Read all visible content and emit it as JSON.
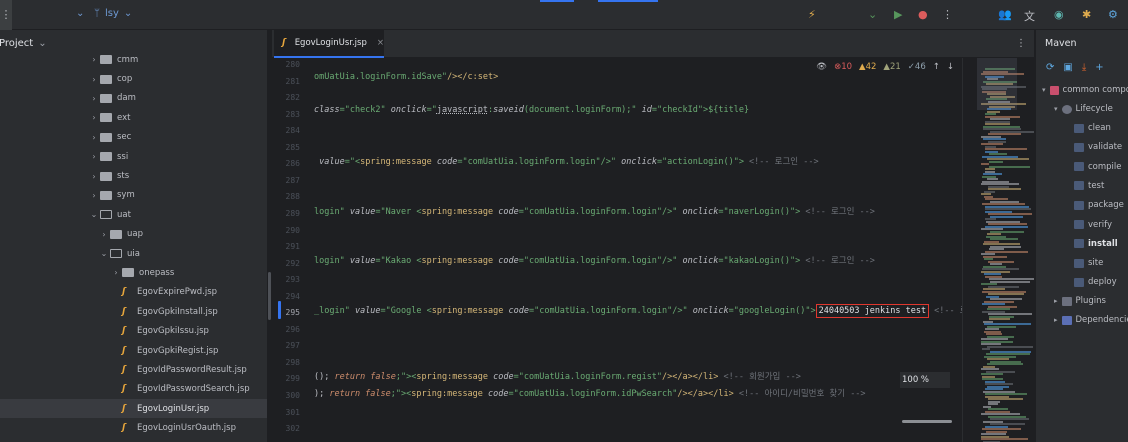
{
  "toolbar": {
    "menu_icon": "⋮",
    "vcs_chevron": "⌄",
    "branch_label": "lsy",
    "branch_chevron": "⌄",
    "right_icons": [
      {
        "name": "run-config-icon",
        "glyph": "⚡",
        "color": "#e0ac4e"
      },
      {
        "name": "run-config-chevron-icon",
        "glyph": "⌄",
        "color": "#57965c"
      },
      {
        "name": "run-icon",
        "glyph": "▶",
        "color": "#57965c"
      },
      {
        "name": "debug-icon",
        "glyph": "●",
        "color": "#db5c5c"
      },
      {
        "name": "more-actions-icon",
        "glyph": "⋮",
        "color": "#bcbec4"
      },
      {
        "name": "collab-icon",
        "glyph": "👥",
        "color": "#e0ac4e"
      },
      {
        "name": "translate-icon",
        "glyph": "文",
        "color": "#bcbec4"
      },
      {
        "name": "copilot-icon",
        "glyph": "◉",
        "color": "#5fb8b1"
      },
      {
        "name": "tools-icon",
        "glyph": "✱",
        "color": "#e0ac4e"
      },
      {
        "name": "settings-icon",
        "glyph": "⚙",
        "color": "#5fa8e0"
      }
    ]
  },
  "project": {
    "title": "Project",
    "title_chevron": "⌄",
    "tree": [
      {
        "label": "cmm",
        "type": "folder",
        "state": "closed",
        "indent": 88
      },
      {
        "label": "cop",
        "type": "folder",
        "state": "closed",
        "indent": 88
      },
      {
        "label": "dam",
        "type": "folder",
        "state": "closed",
        "indent": 88
      },
      {
        "label": "ext",
        "type": "folder",
        "state": "closed",
        "indent": 88
      },
      {
        "label": "sec",
        "type": "folder",
        "state": "closed",
        "indent": 88
      },
      {
        "label": "ssi",
        "type": "folder",
        "state": "closed",
        "indent": 88
      },
      {
        "label": "sts",
        "type": "folder",
        "state": "closed",
        "indent": 88
      },
      {
        "label": "sym",
        "type": "folder",
        "state": "closed",
        "indent": 88
      },
      {
        "label": "uat",
        "type": "folder",
        "state": "open",
        "indent": 88
      },
      {
        "label": "uap",
        "type": "folder",
        "state": "closed",
        "indent": 98
      },
      {
        "label": "uia",
        "type": "folder",
        "state": "open",
        "indent": 98
      },
      {
        "label": "onepass",
        "type": "folder",
        "state": "closed",
        "indent": 110
      },
      {
        "label": "EgovExpirePwd.jsp",
        "type": "jsp",
        "indent": 122
      },
      {
        "label": "EgovGpkiInstall.jsp",
        "type": "jsp",
        "indent": 122
      },
      {
        "label": "EgovGpkiIssu.jsp",
        "type": "jsp",
        "indent": 122
      },
      {
        "label": "EgovGpkiRegist.jsp",
        "type": "jsp",
        "indent": 122
      },
      {
        "label": "EgovIdPasswordResult.jsp",
        "type": "jsp",
        "indent": 122
      },
      {
        "label": "EgovIdPasswordSearch.jsp",
        "type": "jsp",
        "indent": 122
      },
      {
        "label": "EgovLoginUsr.jsp",
        "type": "jsp",
        "indent": 122,
        "selected": true
      },
      {
        "label": "EgovLoginUsrOauth.jsp",
        "type": "jsp",
        "indent": 122
      }
    ]
  },
  "editor": {
    "tab_label": "EgovLoginUsr.jsp",
    "tab_close": "×",
    "tabs_more": "⋮",
    "inspection": {
      "eye": "👁",
      "errors": "10",
      "warnings": "42",
      "weak_warnings": "21",
      "typos": "46",
      "up": "↑",
      "down": "↓"
    },
    "line_numbers": [
      "280",
      "281",
      "282",
      "283",
      "284",
      "285",
      "286",
      "287",
      "288",
      "289",
      "290",
      "291",
      "292",
      "293",
      "294",
      "295",
      "296",
      "297",
      "298",
      "299",
      "300",
      "301",
      "302"
    ],
    "current_line": "295",
    "zoom": "100 %",
    "lines": {
      "l281": {
        "a": "omUatUia.loginForm.idSave\"",
        "b": "/></",
        "c": "c:set",
        "d": ">"
      },
      "l283": {
        "a": "class",
        "b": "=\"check2\" ",
        "c": "onclick",
        "d": "=\"",
        "e": "javascript",
        "f": ":",
        "g": "saveid",
        "h": "(document.loginForm);\" ",
        "i": "id",
        "j": "=\"checkId\">${title}"
      },
      "l286": {
        "a": " value",
        "b": "=\"<",
        "c": "spring:message ",
        "d": "code",
        "e": "=\"comUatUia.loginForm.login\"",
        "f": "/>\" ",
        "g": "onclick",
        "h": "=\"actionLogin()\">",
        "i": " <!-- 로그인 -->"
      },
      "l289": {
        "a": "login\" ",
        "b": "value",
        "c": "=\"Naver <",
        "d": "spring:message ",
        "e": "code",
        "f": "=\"comUatUia.loginForm.login\"",
        "g": "/>\" ",
        "h": "onclick",
        "i": "=\"naverLogin()\">",
        "j": " <!-- 로그인 -->"
      },
      "l292": {
        "a": "login\" ",
        "b": "value",
        "c": "=\"Kakao <",
        "d": "spring:message ",
        "e": "code",
        "f": "=\"comUatUia.loginForm.login\"",
        "g": "/>\" ",
        "h": "onclick",
        "i": "=\"kakaoLogin()\">",
        "j": " <!-- 로그인 -->"
      },
      "l295": {
        "a": "_login\" ",
        "b": "value",
        "c": "=\"Google <",
        "d": "spring:message ",
        "e": "code",
        "f": "=\"comUatUia.loginForm.login\"",
        "g": "/>\" ",
        "h": "onclick",
        "i": "=\"googleLogin()\">",
        "boxed": "24040503 jenkins test",
        "j": " <!-- 로그인 -->"
      },
      "l299": {
        "a": "(); ",
        "b": "return false",
        "c": ";\"><",
        "d": "spring:message ",
        "e": "code",
        "f": "=\"comUatUia.loginForm.regist\"",
        "g": "/></",
        "h": "a",
        "i": "></",
        "j": "li",
        "k": ">",
        "l": " <!-- 회원가입 -->"
      },
      "l300": {
        "a": "); ",
        "b": "return false",
        "c": ";\"><",
        "d": "spring:message ",
        "e": "code",
        "f": "=\"comUatUia.loginForm.idPwSearch\"",
        "g": "/></",
        "h": "a",
        "i": "></",
        "j": "li",
        "k": ">",
        "l": " <!-- 아이디/비밀번호 찾기 -->"
      }
    }
  },
  "maven": {
    "title": "Maven",
    "tools": [
      {
        "name": "reload-icon",
        "glyph": "⟳",
        "color": "#5fa8e0"
      },
      {
        "name": "add-project-icon",
        "glyph": "▣",
        "color": "#5fa8e0"
      },
      {
        "name": "download-icon",
        "glyph": "⤓",
        "color": "#e0672e"
      },
      {
        "name": "add-icon",
        "glyph": "+",
        "color": "#5fa8e0"
      }
    ],
    "project_label": "common compo",
    "lifecycle_label": "Lifecycle",
    "goals": [
      "clean",
      "validate",
      "compile",
      "test",
      "package",
      "verify",
      "install",
      "site",
      "deploy"
    ],
    "plugins_label": "Plugins",
    "dependencies_label": "Dependencies"
  }
}
